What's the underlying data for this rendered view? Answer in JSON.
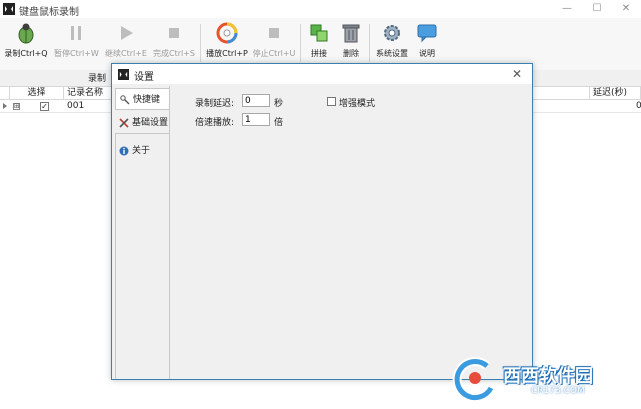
{
  "window": {
    "title": "键盘鼠标录制",
    "minimize": "—",
    "maximize": "☐",
    "close": "✕"
  },
  "toolbar": {
    "record": "录制Ctrl+Q",
    "pause": "暂停Ctrl+W",
    "resume": "继续Ctrl+E",
    "finish": "完成Ctrl+S",
    "play": "播放Ctrl+P",
    "stop": "停止Ctrl+U",
    "merge": "拼接",
    "delete": "删除",
    "system_settings": "系统设置",
    "help": "说明",
    "group_record": "录制"
  },
  "grid": {
    "headers": {
      "select": "选择",
      "name": "记录名称",
      "delay": "延迟(秒)"
    },
    "rows": [
      {
        "expand": "⊞",
        "checked": "✓",
        "name": "001",
        "delay": "0"
      }
    ]
  },
  "dialog": {
    "title": "设置",
    "close": "✕",
    "tabs": {
      "hotkeys": "快捷键",
      "basic": "基础设置",
      "about": "关于"
    },
    "basic": {
      "record_delay_label": "录制延迟:",
      "record_delay_value": "0",
      "record_delay_unit": "秒",
      "speed_label": "倍速播放:",
      "speed_value": "1",
      "speed_unit": "倍",
      "enhanced_mode_label": "增强模式"
    }
  },
  "watermark": {
    "text": "西西软件园",
    "sub": "CR173.COM"
  },
  "colors": {
    "dialog_border": "#3c7fb1",
    "play_icon_ring": "#e8502f",
    "merge_icon": "#5ab24a",
    "help_icon": "#4a9ee0"
  }
}
